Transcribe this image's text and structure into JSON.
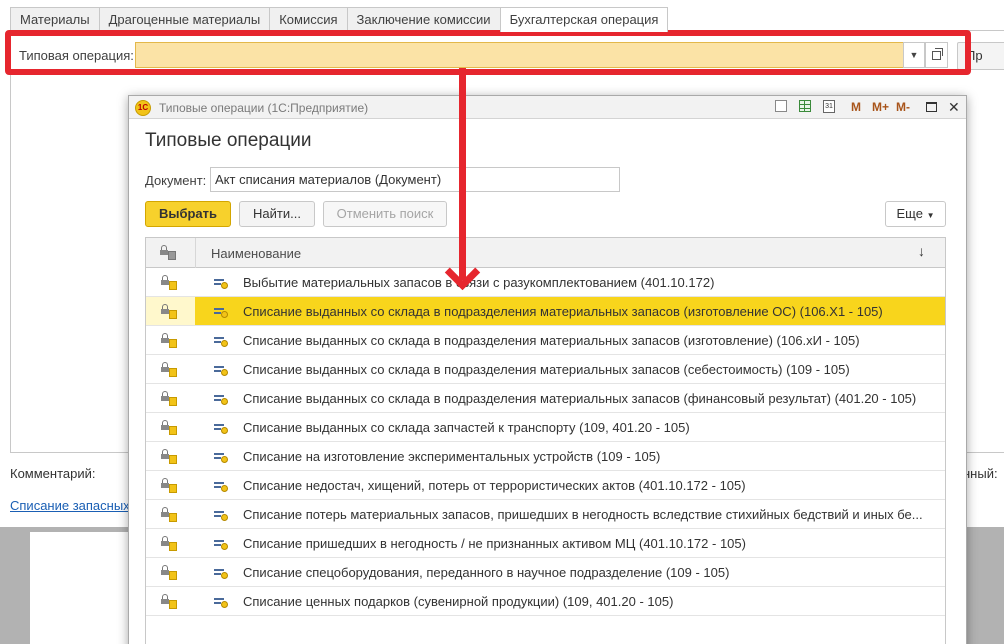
{
  "tabs": [
    {
      "label": "Материалы",
      "active": false
    },
    {
      "label": "Драгоценные материалы",
      "active": false
    },
    {
      "label": "Комиссия",
      "active": false
    },
    {
      "label": "Заключение комиссии",
      "active": false
    },
    {
      "label": "Бухгалтерская операция",
      "active": true
    }
  ],
  "form": {
    "operation_label": "Типовая операция:",
    "operation_value": "",
    "right_button_label": "Пр",
    "comment_label": "Комментарий:",
    "right_label": "нный:",
    "link_text": "Списание запасных"
  },
  "modal": {
    "window_title": "Типовые операции  (1С:Предприятие)",
    "heading": "Типовые операции",
    "document_label": "Документ:",
    "document_value": "Акт списания материалов (Документ)",
    "toolbar": {
      "memory_labels": [
        "M",
        "M+",
        "M-"
      ],
      "calendar_label": "31"
    },
    "buttons": {
      "select": "Выбрать",
      "find": "Найти...",
      "cancel_search": "Отменить поиск",
      "more": "Еще"
    },
    "list": {
      "column_name": "Наименование",
      "sort_indicator": "↓",
      "rows": [
        {
          "text": "Выбытие материальных запасов в связи с разукомплектованием (401.10.172)",
          "selected": false
        },
        {
          "text": "Списание выданных со склада в подразделения материальных запасов (изготовление ОС) (106.Х1 - 105)",
          "selected": true
        },
        {
          "text": "Списание выданных со склада в подразделения материальных запасов (изготовление) (106.хИ - 105)",
          "selected": false
        },
        {
          "text": "Списание выданных со склада в подразделения материальных запасов (себестоимость) (109 - 105)",
          "selected": false
        },
        {
          "text": "Списание выданных со склада в подразделения материальных запасов (финансовый результат) (401.20 - 105)",
          "selected": false
        },
        {
          "text": "Списание выданных со склада запчастей к транспорту (109, 401.20 - 105)",
          "selected": false
        },
        {
          "text": "Списание на изготовление экспериментальных устройств (109 - 105)",
          "selected": false
        },
        {
          "text": "Списание недостач, хищений, потерь от террористических актов (401.10.172 - 105)",
          "selected": false
        },
        {
          "text": "Списание потерь материальных запасов, пришедших в негодность вследствие стихийных бедствий и иных бе...",
          "selected": false
        },
        {
          "text": "Списание пришедших в негодность / не признанных активом МЦ (401.10.172 - 105)",
          "selected": false
        },
        {
          "text": "Списание спецоборудования, переданного в научное подразделение (109 - 105)",
          "selected": false
        },
        {
          "text": "Списание ценных подарков (сувенирной продукции) (109, 401.20 - 105)",
          "selected": false
        }
      ]
    }
  },
  "colors": {
    "accent_yellow": "#f8d51c",
    "field_highlight": "#fbe3a6",
    "annotation_red": "#e6262e"
  },
  "icons": [
    "lock-cube-icon",
    "operation-icon",
    "dropdown-arrow-icon",
    "open-icon",
    "calendar-icon",
    "calculator-icon",
    "document-icon",
    "maximize-icon",
    "close-icon"
  ]
}
